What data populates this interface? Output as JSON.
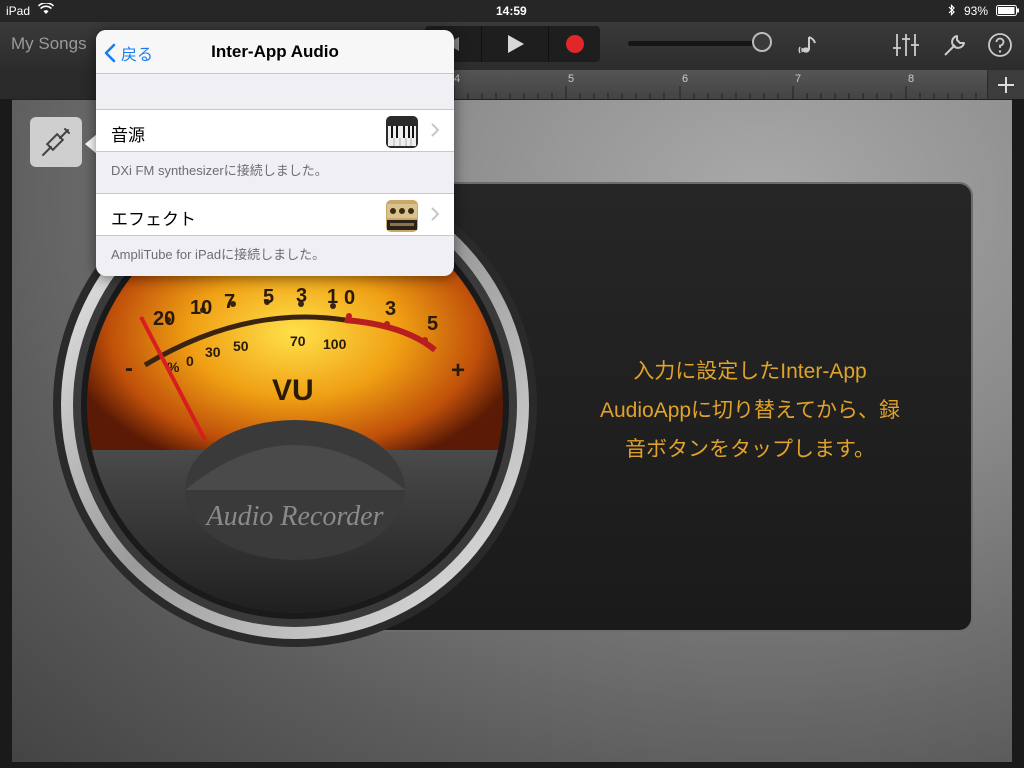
{
  "status_bar": {
    "device": "iPad",
    "time": "14:59",
    "battery": "93%"
  },
  "toolbar": {
    "my_songs": "My Songs"
  },
  "ruler": {
    "marks": [
      "4",
      "5",
      "6",
      "7",
      "8"
    ]
  },
  "popover": {
    "back_label": "戻る",
    "title": "Inter-App Audio",
    "rows": [
      {
        "label": "音源",
        "note": "DXi FM synthesizerに接続しました。",
        "icon": "piano-app-icon"
      },
      {
        "label": "エフェクト",
        "note": "AmpliTube for iPadに接続しました。",
        "icon": "amp-app-icon"
      }
    ]
  },
  "meter": {
    "upper_scale": [
      "20",
      "10",
      "7",
      "5",
      "3",
      "1",
      "0",
      "3",
      "5"
    ],
    "lower_scale": [
      "%",
      "0",
      "30",
      "50",
      "70",
      "100"
    ],
    "minus": "-",
    "plus": "+",
    "label": "VU",
    "brand": "Audio Recorder"
  },
  "instruction": {
    "lines": [
      "入力に設定したInter-App",
      "AudioAppに切り替えてから、録",
      "音ボタンをタップします。"
    ]
  },
  "colors": {
    "accent_orange": "#e0a22a",
    "ios_blue": "#1a7cf5",
    "record_red": "#e0282a",
    "needle": "#d81e1e"
  }
}
